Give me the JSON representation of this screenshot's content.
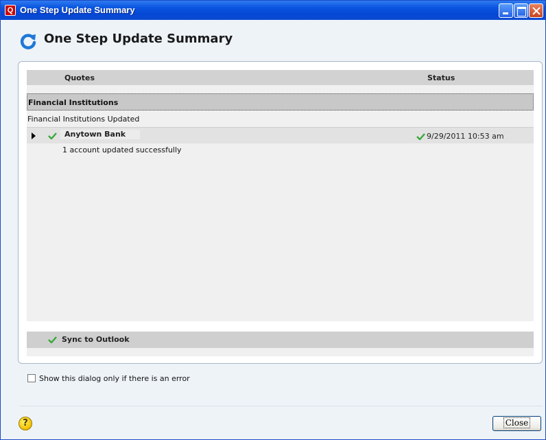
{
  "window": {
    "title": "One Step Update Summary",
    "app_icon_letter": "Q"
  },
  "header": {
    "title": "One Step Update Summary",
    "icon": "refresh-icon"
  },
  "table": {
    "columns": [
      "Quotes",
      "Status"
    ],
    "group": {
      "title": "Financial Institutions",
      "subtitle": "Financial Institutions Updated"
    },
    "rows": [
      {
        "name": "Anytown Bank",
        "status": "9/29/2011  10:53 am",
        "detail": "1 account updated successfully"
      }
    ],
    "sync": {
      "label": "Sync to Outlook"
    }
  },
  "footer": {
    "checkbox_label": "Show this dialog only if there is an error",
    "checkbox_checked": false,
    "close_label": "Close",
    "help_symbol": "?"
  },
  "colors": {
    "check_green": "#3aa83a",
    "refresh_blue": "#1e78d8"
  }
}
